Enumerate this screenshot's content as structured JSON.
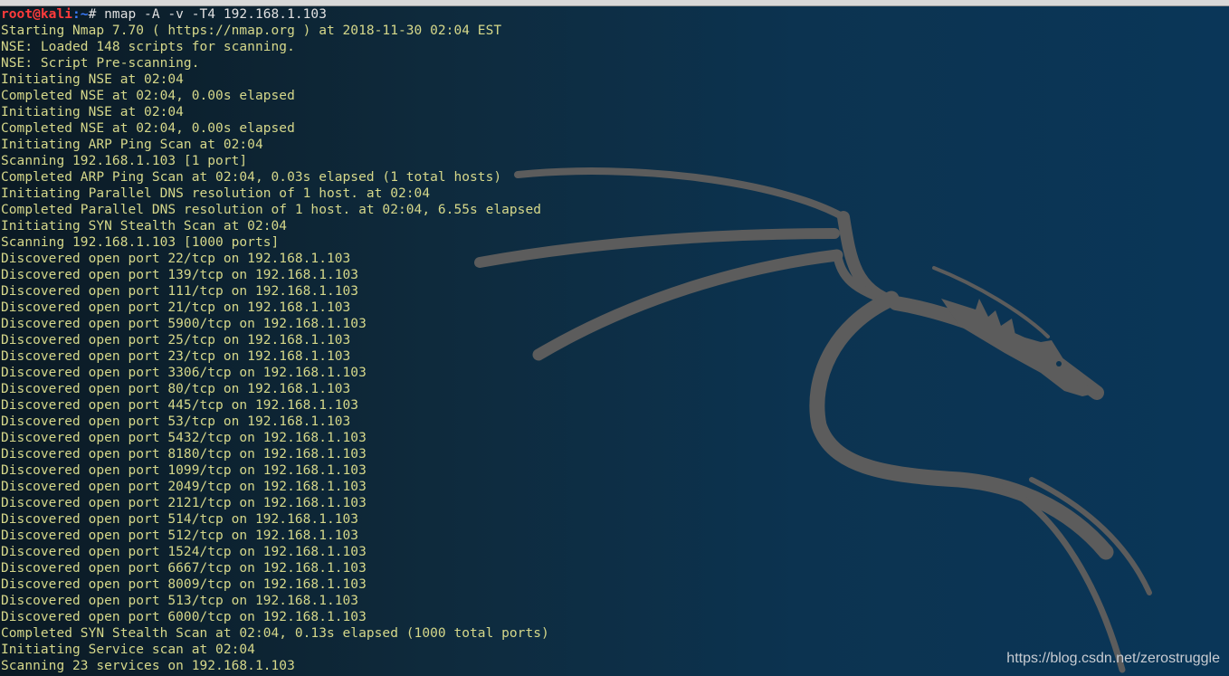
{
  "prompt": {
    "user_host": "root@kali",
    "path": ":~",
    "symbol": "# ",
    "command": "nmap -A -v -T4 192.168.1.103"
  },
  "output_lines": [
    "Starting Nmap 7.70 ( https://nmap.org ) at 2018-11-30 02:04 EST",
    "NSE: Loaded 148 scripts for scanning.",
    "NSE: Script Pre-scanning.",
    "Initiating NSE at 02:04",
    "Completed NSE at 02:04, 0.00s elapsed",
    "Initiating NSE at 02:04",
    "Completed NSE at 02:04, 0.00s elapsed",
    "Initiating ARP Ping Scan at 02:04",
    "Scanning 192.168.1.103 [1 port]",
    "Completed ARP Ping Scan at 02:04, 0.03s elapsed (1 total hosts)",
    "Initiating Parallel DNS resolution of 1 host. at 02:04",
    "Completed Parallel DNS resolution of 1 host. at 02:04, 6.55s elapsed",
    "Initiating SYN Stealth Scan at 02:04",
    "Scanning 192.168.1.103 [1000 ports]",
    "Discovered open port 22/tcp on 192.168.1.103",
    "Discovered open port 139/tcp on 192.168.1.103",
    "Discovered open port 111/tcp on 192.168.1.103",
    "Discovered open port 21/tcp on 192.168.1.103",
    "Discovered open port 5900/tcp on 192.168.1.103",
    "Discovered open port 25/tcp on 192.168.1.103",
    "Discovered open port 23/tcp on 192.168.1.103",
    "Discovered open port 3306/tcp on 192.168.1.103",
    "Discovered open port 80/tcp on 192.168.1.103",
    "Discovered open port 445/tcp on 192.168.1.103",
    "Discovered open port 53/tcp on 192.168.1.103",
    "Discovered open port 5432/tcp on 192.168.1.103",
    "Discovered open port 8180/tcp on 192.168.1.103",
    "Discovered open port 1099/tcp on 192.168.1.103",
    "Discovered open port 2049/tcp on 192.168.1.103",
    "Discovered open port 2121/tcp on 192.168.1.103",
    "Discovered open port 514/tcp on 192.168.1.103",
    "Discovered open port 512/tcp on 192.168.1.103",
    "Discovered open port 1524/tcp on 192.168.1.103",
    "Discovered open port 6667/tcp on 192.168.1.103",
    "Discovered open port 8009/tcp on 192.168.1.103",
    "Discovered open port 513/tcp on 192.168.1.103",
    "Discovered open port 6000/tcp on 192.168.1.103",
    "Completed SYN Stealth Scan at 02:04, 0.13s elapsed (1000 total ports)",
    "Initiating Service scan at 02:04",
    "Scanning 23 services on 192.168.1.103"
  ],
  "watermark": "https://blog.csdn.net/zerostruggle",
  "colors": {
    "output_text": "#d6d88a",
    "prompt_user": "#ff3b3b",
    "prompt_path": "#3b7cff",
    "dragon": "#5c5c5c"
  }
}
